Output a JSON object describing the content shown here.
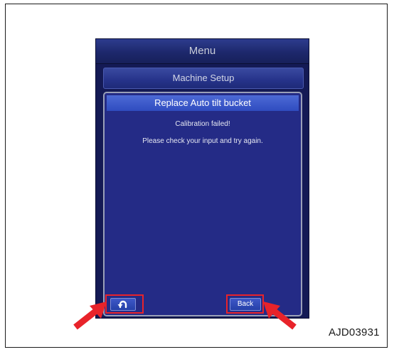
{
  "menu": {
    "title": "Menu"
  },
  "setup": {
    "title": "Machine Setup"
  },
  "dialog": {
    "title": "Replace Auto tilt bucket",
    "message_line1": "Calibration failed!",
    "message_line2": "Please check your input and try again."
  },
  "buttons": {
    "undo_icon": "undo-icon",
    "back_label": "Back"
  },
  "colors": {
    "highlight": "#e8232a",
    "panel": "#242b86",
    "header": "#3a58cc"
  },
  "figure": {
    "code": "AJD03931"
  }
}
